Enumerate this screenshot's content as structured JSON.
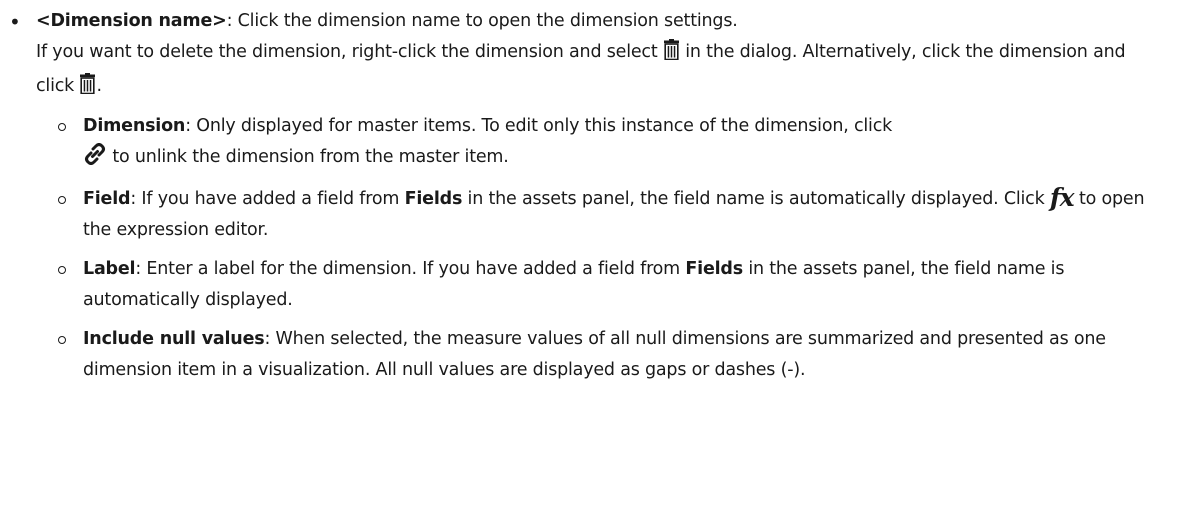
{
  "item": {
    "term": "<Dimension name>",
    "desc": ": Click the dimension name to open the dimension settings.",
    "line2_a": "If you want to delete the dimension, right-click the dimension and select ",
    "line2_b": " in the dialog. Alternatively, click the dimension and click ",
    "line2_c": ".",
    "delete_icon": "trash-icon"
  },
  "subitems": [
    {
      "term": "Dimension",
      "text_a": ": Only displayed for master items. To edit only this instance of the dimension, click ",
      "text_b": " to unlink the dimension from the master item.",
      "icon": "unlink-icon"
    },
    {
      "term": "Field",
      "text_a": ": If you have added a field from ",
      "bold_mid": "Fields",
      "text_b": " in the assets panel, the field name is automatically displayed. Click ",
      "fx_symbol": "fx",
      "text_c": " to open the expression editor."
    },
    {
      "term": "Label",
      "text_a": ": Enter a label for the dimension. If you have added a field from ",
      "bold_mid": "Fields",
      "text_b": " in the assets panel, the field name is automatically displayed."
    },
    {
      "term": "Include null values",
      "text_a": ": When selected, the measure values of all null dimensions are summarized and presented as one dimension item in a visualization. All null values are displayed as gaps or dashes (-)."
    }
  ]
}
